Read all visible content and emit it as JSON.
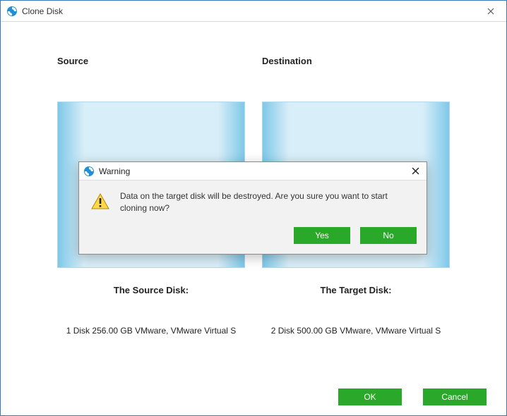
{
  "window": {
    "title": "Clone Disk"
  },
  "headers": {
    "source": "Source",
    "destination": "Destination"
  },
  "labels": {
    "source_disk": "The Source Disk:",
    "target_disk": "The Target Disk:"
  },
  "disks": {
    "source": "1 Disk 256.00 GB VMware,  VMware Virtual S",
    "target": "2 Disk 500.00 GB VMware,  VMware Virtual S"
  },
  "buttons": {
    "ok": "OK",
    "cancel": "Cancel"
  },
  "dialog": {
    "title": "Warning",
    "message": "Data on the target disk will be destroyed. Are you sure you want to start cloning now?",
    "yes": "Yes",
    "no": "No"
  },
  "colors": {
    "accent_green": "#2aa82a",
    "window_border": "#3a78b8"
  }
}
